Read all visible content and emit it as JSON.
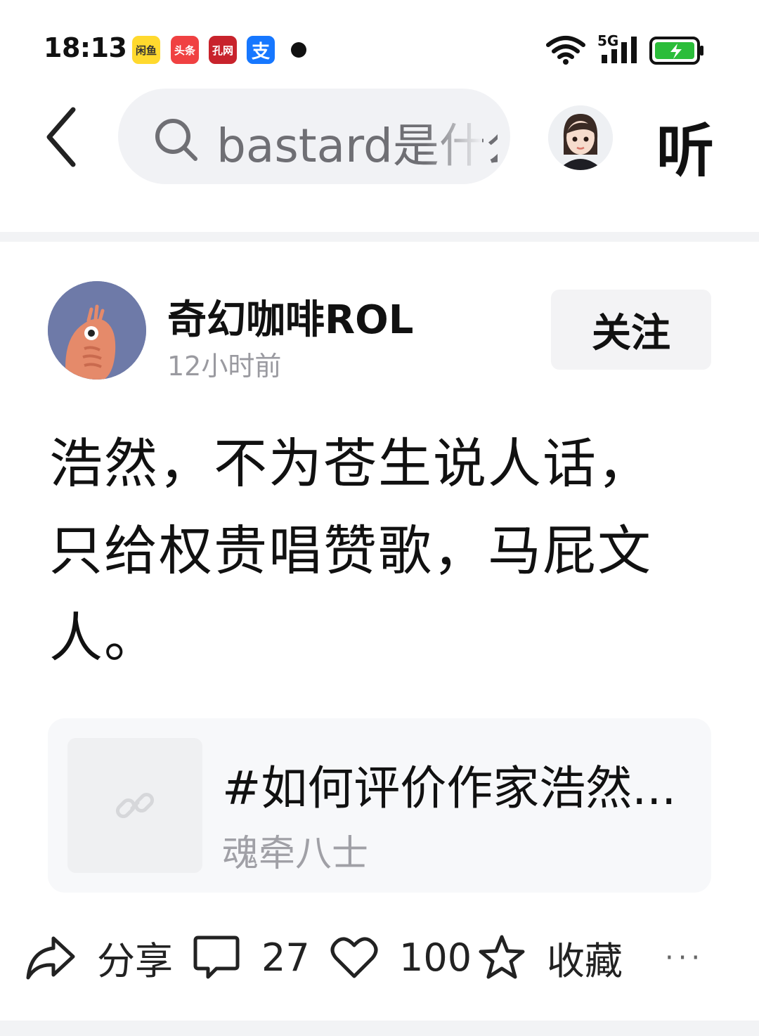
{
  "status_bar": {
    "time": "18:13",
    "apps": [
      {
        "icon": "fortune-app-icon",
        "label": "闲鱼",
        "color": "#ffd92e"
      },
      {
        "icon": "toutiao-icon",
        "label": "头条",
        "color": "#f04142"
      },
      {
        "icon": "kongwang-icon",
        "label": "孔网",
        "color": "#c8232c"
      },
      {
        "icon": "alipay-icon",
        "label": "支",
        "color": "#1677ff"
      }
    ],
    "network": "5G",
    "battery_color": "#2bbd3a"
  },
  "top_bar": {
    "search_query": "bastard是什么意思",
    "listen_label": "听"
  },
  "post": {
    "author_name": "奇幻咖啡ROL",
    "time": "12小时前",
    "follow_label": "关注",
    "content": "浩然，不为苍生说人话，只给权贵唱赞歌，马屁文人。"
  },
  "link_card": {
    "title": "#如何评价作家浩然...",
    "subtitle": "魂牵八士"
  },
  "actions": {
    "share_label": "分享",
    "comment_count": "27",
    "like_count": "100",
    "favorite_label": "收藏",
    "more_label": "···"
  }
}
